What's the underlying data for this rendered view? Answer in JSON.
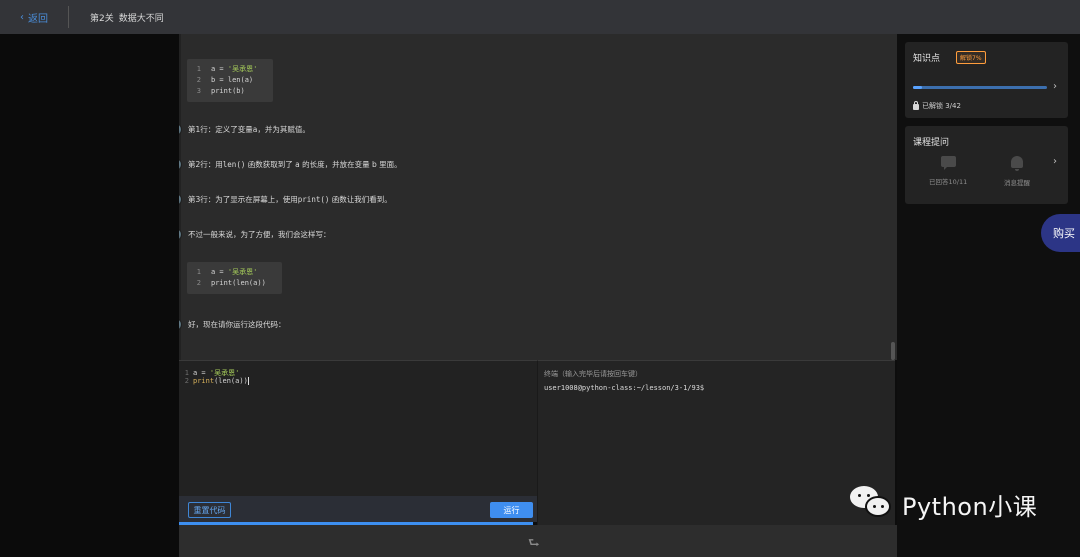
{
  "header": {
    "back_label": "返回",
    "level": "第2关",
    "level_title": "数据大不同"
  },
  "lesson": {
    "code_block_1": [
      {
        "ln": "1",
        "pre": "a = ",
        "str": "'吴承恩'"
      },
      {
        "ln": "2",
        "pre": "b = len(a)",
        "str": ""
      },
      {
        "ln": "3",
        "pre": "print(b)",
        "str": ""
      }
    ],
    "messages": [
      {
        "prefix": "第1行：定义了变量",
        "code": "a",
        "suffix": "，并为其赋值。"
      },
      {
        "prefix": "第2行：用",
        "code": "len()",
        "suffix": " 函数获取到了 a 的长度，并放在变量 b 里面。"
      },
      {
        "prefix": "第3行：为了显示在屏幕上，使用",
        "code": "print()",
        "suffix": " 函数让我们看到。"
      },
      {
        "prefix": "不过一般来说，为了方便，我们会这样写：",
        "code": "",
        "suffix": ""
      }
    ],
    "code_block_2": [
      {
        "ln": "1",
        "pre": "a = ",
        "str": "'吴承恩'"
      },
      {
        "ln": "2",
        "pre": "print(len(a))",
        "str": ""
      }
    ],
    "final_message": "好，现在请你运行这段代码："
  },
  "editor": {
    "lines": [
      {
        "ln": "1",
        "a": "a = ",
        "b": "'吴承恩'"
      },
      {
        "ln": "2",
        "a": "print",
        "b": "(len(a))"
      }
    ],
    "reset_label": "重置代码",
    "run_label": "运行"
  },
  "terminal": {
    "title": "终端（输入完毕后请按回车键）",
    "prompt": "user1008@python-class:~/lesson/3-1/93$"
  },
  "sidebar": {
    "knowledge": {
      "title": "知识点",
      "badge": "解锁7%",
      "progress": 0.07,
      "unlocked": "已解锁 3/42"
    },
    "questions": {
      "title": "课程提问",
      "answered": "已回答10/11",
      "remind": "消息提醒"
    },
    "buy_label": "购买"
  },
  "watermark": {
    "text": "Python小课"
  },
  "colors": {
    "accent": "#3f8ef0",
    "badge": "#ff9d3c",
    "string": "#a6cc5a",
    "buy": "#2c3586"
  }
}
